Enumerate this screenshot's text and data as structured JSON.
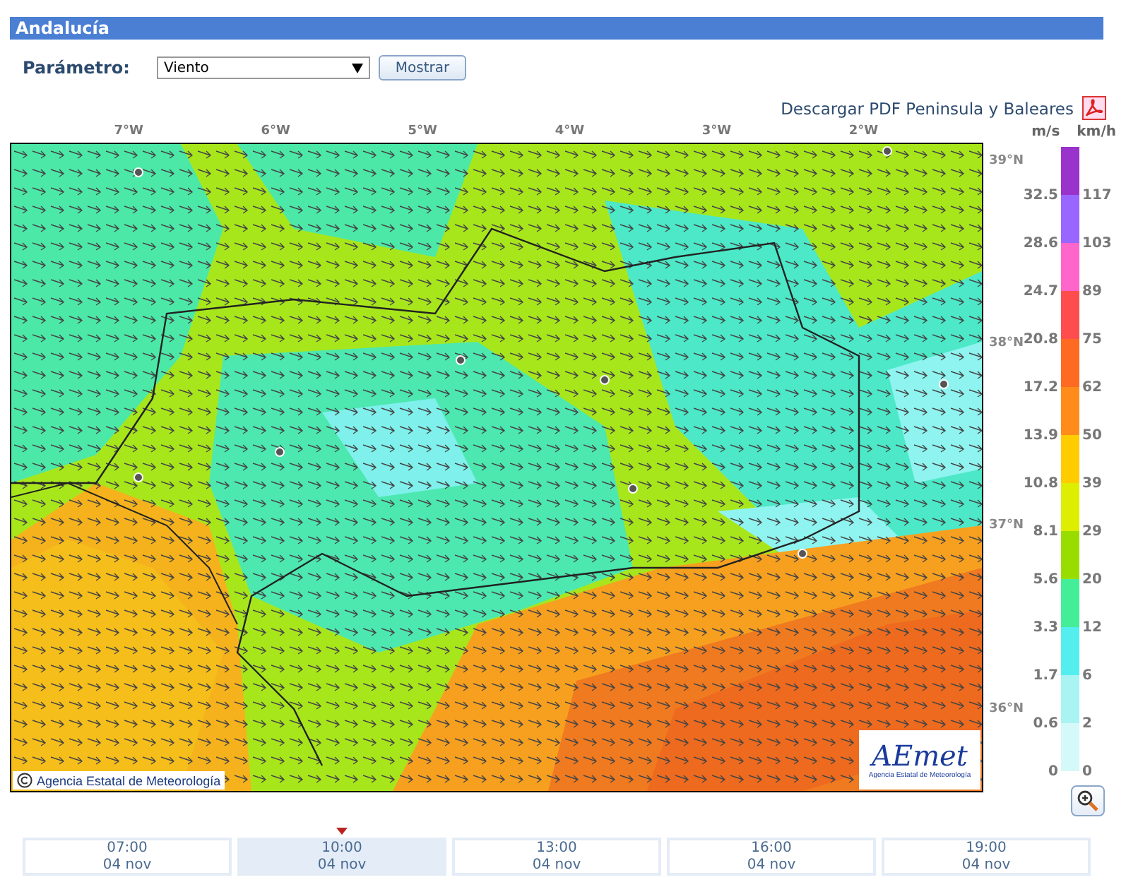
{
  "header": {
    "title": "Andalucía"
  },
  "parameter": {
    "label": "Parámetro:",
    "value": "Viento",
    "button": "Mostrar"
  },
  "download_link": "Descargar PDF Peninsula y Baleares",
  "map": {
    "longitudes": [
      "7°W",
      "6°W",
      "5°W",
      "4°W",
      "3°W",
      "2°W"
    ],
    "latitudes": [
      "39°N",
      "38°N",
      "37°N",
      "36°N"
    ],
    "copyright": "Agencia Estatal de Meteorología",
    "logo": {
      "mark": "AEmet",
      "subtitle": "Agencia Estatal de Meteorología"
    }
  },
  "legend": {
    "units": [
      "m/s",
      "km/h"
    ],
    "steps": [
      {
        "ms": "32.5",
        "kmh": "117",
        "color": "#9933cc"
      },
      {
        "ms": "28.6",
        "kmh": "103",
        "color": "#9966ff"
      },
      {
        "ms": "24.7",
        "kmh": "89",
        "color": "#ff66cc"
      },
      {
        "ms": "20.8",
        "kmh": "75",
        "color": "#ff4d4d"
      },
      {
        "ms": "17.2",
        "kmh": "62",
        "color": "#ff6a22"
      },
      {
        "ms": "13.9",
        "kmh": "50",
        "color": "#ff8c1a"
      },
      {
        "ms": "10.8",
        "kmh": "39",
        "color": "#ffcc00"
      },
      {
        "ms": "8.1",
        "kmh": "29",
        "color": "#ddee00"
      },
      {
        "ms": "5.6",
        "kmh": "20",
        "color": "#99dd00"
      },
      {
        "ms": "3.3",
        "kmh": "12",
        "color": "#44ee99"
      },
      {
        "ms": "1.7",
        "kmh": "6",
        "color": "#55eeee"
      },
      {
        "ms": "0.6",
        "kmh": "2",
        "color": "#aaf3f3"
      },
      {
        "ms": "0",
        "kmh": "0",
        "color": "#d5f8f8"
      }
    ]
  },
  "timeline": [
    {
      "time": "07:00",
      "date": "04 nov",
      "selected": false
    },
    {
      "time": "10:00",
      "date": "04 nov",
      "selected": true
    },
    {
      "time": "13:00",
      "date": "04 nov",
      "selected": false
    },
    {
      "time": "16:00",
      "date": "04 nov",
      "selected": false
    },
    {
      "time": "19:00",
      "date": "04 nov",
      "selected": false
    }
  ]
}
